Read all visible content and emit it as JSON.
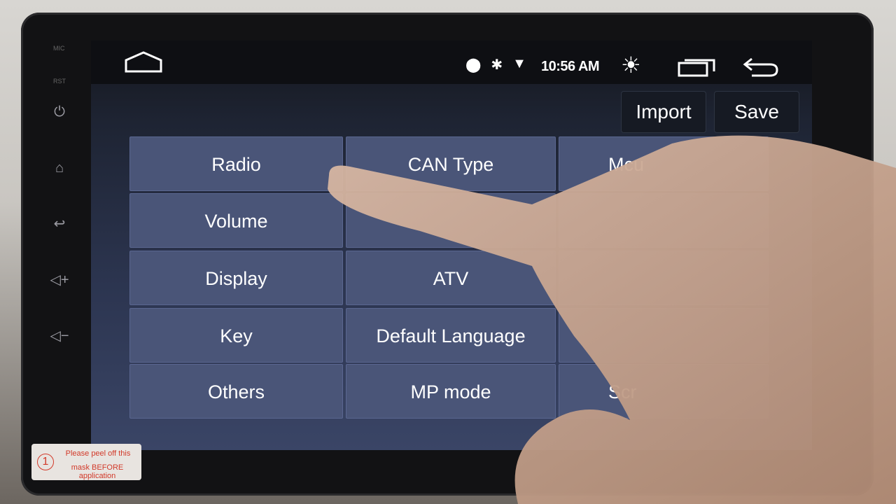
{
  "device": {
    "side_labels": {
      "mic": "MIC",
      "rst": "RST"
    },
    "side_buttons": [
      "power-icon",
      "home-icon",
      "back-icon",
      "volume-up-icon",
      "volume-down-icon"
    ],
    "sticker": {
      "number": "1",
      "line1": "Please peel off this",
      "line2": "mask BEFORE application"
    }
  },
  "statusbar": {
    "icons": [
      "location-icon",
      "bluetooth-icon",
      "wifi-icon"
    ],
    "time": "10:56 AM"
  },
  "toolbar": {
    "import_label": "Import",
    "save_label": "Save"
  },
  "grid": {
    "col1": [
      "Radio",
      "Volume",
      "Display",
      "Key",
      "Others"
    ],
    "col2": [
      "CAN Type",
      "",
      "ATV",
      "Default Language",
      "MP mode"
    ],
    "col3": [
      "Mcu",
      "",
      "",
      "",
      "Scr"
    ]
  },
  "colors": {
    "tile": "#4a5578",
    "screen": "#2c3550"
  }
}
